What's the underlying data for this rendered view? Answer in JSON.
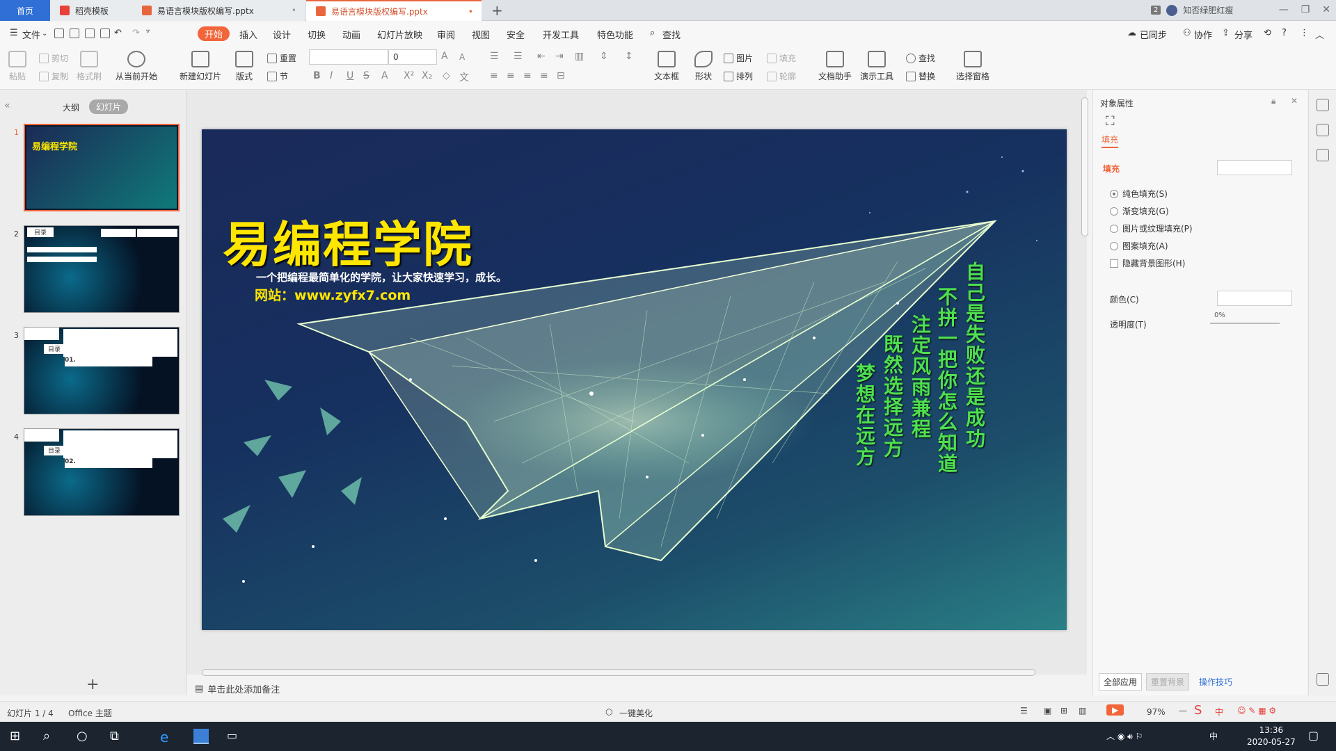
{
  "tabs": {
    "home": "首页",
    "t1": "稻壳模板",
    "t2": "易语言模块版权编写.pptx",
    "t3": "易语言模块版权编写.pptx",
    "close": "•",
    "add": "+"
  },
  "user": {
    "badge": "2",
    "name": "知否绿肥红瘦"
  },
  "menu": {
    "file": "文件",
    "items": [
      "开始",
      "插入",
      "设计",
      "切换",
      "动画",
      "幻灯片放映",
      "审阅",
      "视图",
      "安全",
      "开发工具",
      "特色功能"
    ],
    "search": "查找",
    "sync": "已同步",
    "collab": "协作",
    "share": "分享"
  },
  "ribbon": {
    "paste": "粘贴",
    "cut": "剪切",
    "copy": "复制",
    "format_painter": "格式刷",
    "from_current": "从当前开始",
    "new_slide": "新建幻灯片",
    "layout": "版式",
    "reset": "重置",
    "section": "节",
    "font_size": "0",
    "textbox": "文本框",
    "shape": "形状",
    "picture": "图片",
    "fill": "填充",
    "arrange": "排列",
    "outline": "轮廓",
    "doc_assist": "文档助手",
    "present_tools": "演示工具",
    "find": "查找",
    "replace": "替换",
    "select_pane": "选择窗格"
  },
  "left": {
    "outline": "大纲",
    "slides": "幻灯片",
    "thumb_title": "易编程学院",
    "thumb_label": "目录",
    "thumb3_num": "01.",
    "thumb4_num": "02."
  },
  "slide": {
    "title": "易编程学院",
    "subtitle": "一个把编程最简单化的学院，让大家快速学习，成长。",
    "website": "网站：www.zyfx7.com",
    "v1": "自己是失败还是成功",
    "v2": "不拼一把你怎么知道",
    "v3": "注定风雨兼程",
    "v4": "既然选择远方",
    "v5": "梦想在远方"
  },
  "notes": "单击此处添加备注",
  "right": {
    "title": "对象属性",
    "fill_tab": "填充",
    "section": "填充",
    "opt_solid": "纯色填充(S)",
    "opt_gradient": "渐变填充(G)",
    "opt_picture": "图片或纹理填充(P)",
    "opt_pattern": "图案填充(A)",
    "opt_hide": "隐藏背景图形(H)",
    "color": "颜色(C)",
    "transparency": "透明度(T)",
    "transparency_value": "0%",
    "apply_all": "全部应用",
    "reset_bg": "重置背景",
    "tips": "操作技巧"
  },
  "status": {
    "slide_pos": "幻灯片 1 / 4",
    "theme": "Office 主题",
    "beautify": "一键美化",
    "zoom": "97%"
  },
  "taskbar": {
    "time": "13:36",
    "date": "2020-05-27",
    "ime": "中"
  },
  "colors": {
    "accent": "#f2653a",
    "brand_blue": "#2f6fd6",
    "title_yellow": "#ffe600",
    "verse_green": "#4ee04e"
  }
}
